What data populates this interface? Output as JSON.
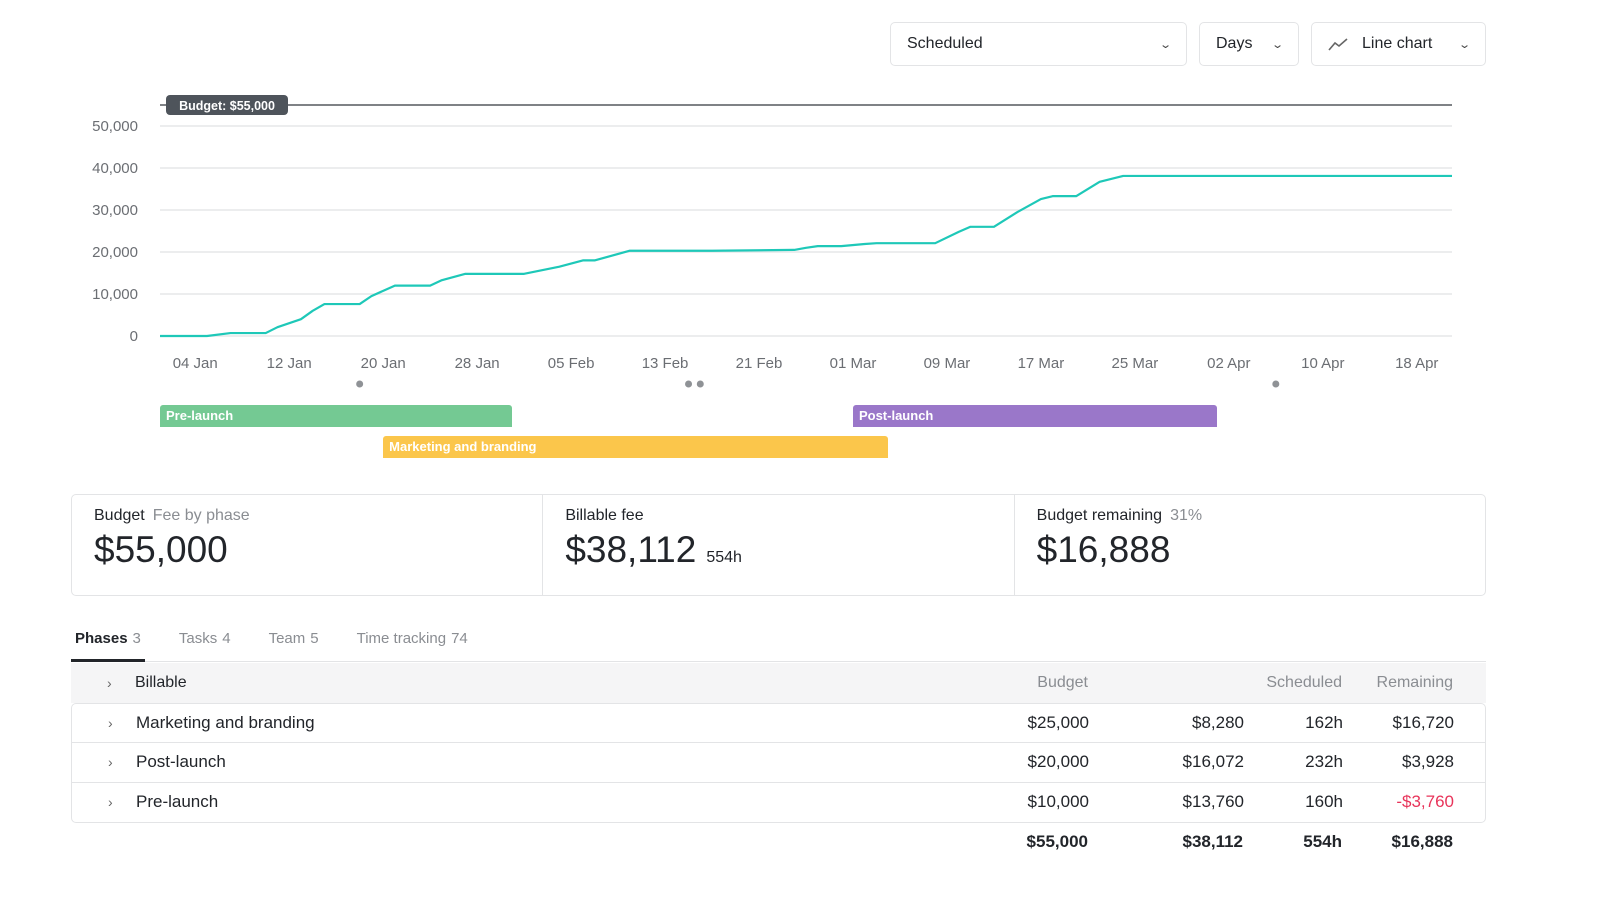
{
  "controls": {
    "metric": "Scheduled",
    "interval": "Days",
    "chart_type": "Line chart",
    "chart_type_icon": "line-chart-icon"
  },
  "chart_data": {
    "type": "line",
    "yticks": [
      "0",
      "10,000",
      "20,000",
      "30,000",
      "40,000",
      "50,000"
    ],
    "ylim": [
      0,
      50000
    ],
    "xlim": [
      "01 Jan",
      "21 Apr"
    ],
    "xticks": [
      "04 Jan",
      "12 Jan",
      "20 Jan",
      "28 Jan",
      "05 Feb",
      "13 Feb",
      "21 Feb",
      "01 Mar",
      "09 Mar",
      "17 Mar",
      "25 Mar",
      "02 Apr",
      "10 Apr",
      "18 Apr"
    ],
    "grid": true,
    "color": "#1ec8b8",
    "budget_line": {
      "value": 55000,
      "label": "Budget: $55,000"
    },
    "series": [
      {
        "x": [
          "01 Jan",
          "05 Jan",
          "07 Jan",
          "10 Jan",
          "11 Jan",
          "13 Jan",
          "14 Jan",
          "15 Jan",
          "18 Jan",
          "19 Jan",
          "21 Jan",
          "24 Jan",
          "25 Jan",
          "27 Jan",
          "01 Feb",
          "04 Feb",
          "06 Feb",
          "07 Feb",
          "10 Feb",
          "17 Feb",
          "24 Feb",
          "25 Feb",
          "26 Feb",
          "28 Feb",
          "02 Mar",
          "03 Mar",
          "08 Mar",
          "10 Mar",
          "11 Mar",
          "13 Mar",
          "15 Mar",
          "17 Mar",
          "18 Mar",
          "20 Mar",
          "22 Mar",
          "24 Mar",
          "21 Apr"
        ],
        "y": [
          0,
          0,
          700,
          700,
          2100,
          4000,
          6000,
          7600,
          7600,
          9500,
          12000,
          12000,
          13300,
          14800,
          14800,
          16500,
          18000,
          18000,
          20300,
          20300,
          20500,
          21000,
          21400,
          21400,
          21900,
          22100,
          22100,
          24800,
          26000,
          26000,
          29500,
          32600,
          33300,
          33300,
          36700,
          38112,
          38112
        ]
      }
    ],
    "milestones": [
      "18 Jan",
      "15 Feb",
      "16 Feb",
      "06 Apr"
    ],
    "phases": [
      {
        "name": "Pre-launch",
        "start": "01 Jan",
        "end": "31 Jan",
        "color": "#74c993",
        "row": 0
      },
      {
        "name": "Marketing and branding",
        "start": "20 Jan",
        "end": "04 Mar",
        "color": "#fbc64b",
        "row": 1
      },
      {
        "name": "Post-launch",
        "start": "01 Mar",
        "end": "01 Apr",
        "color": "#9a77c9",
        "row": 0
      }
    ]
  },
  "summary": {
    "budget": {
      "label": "Budget",
      "sub": "Fee by phase",
      "value": "$55,000"
    },
    "billable": {
      "label": "Billable fee",
      "value": "$38,112",
      "hours": "554h"
    },
    "remaining": {
      "label": "Budget remaining",
      "pct": "31%",
      "value": "$16,888"
    }
  },
  "tabs": [
    {
      "label": "Phases",
      "count": "3"
    },
    {
      "label": "Tasks",
      "count": "4"
    },
    {
      "label": "Team",
      "count": "5"
    },
    {
      "label": "Time tracking",
      "count": "74"
    }
  ],
  "table": {
    "group": "Billable",
    "headers": {
      "budget": "Budget",
      "scheduled": "Scheduled",
      "remaining": "Remaining"
    },
    "rows": [
      {
        "name": "Marketing and branding",
        "budget": "$25,000",
        "scheduled": "$8,280",
        "hours": "162h",
        "remaining": "$16,720"
      },
      {
        "name": "Post-launch",
        "budget": "$20,000",
        "scheduled": "$16,072",
        "hours": "232h",
        "remaining": "$3,928"
      },
      {
        "name": "Pre-launch",
        "budget": "$10,000",
        "scheduled": "$13,760",
        "hours": "160h",
        "remaining": "-$3,760",
        "negative": true
      }
    ],
    "totals": {
      "budget": "$55,000",
      "scheduled": "$38,112",
      "hours": "554h",
      "remaining": "$16,888"
    }
  }
}
